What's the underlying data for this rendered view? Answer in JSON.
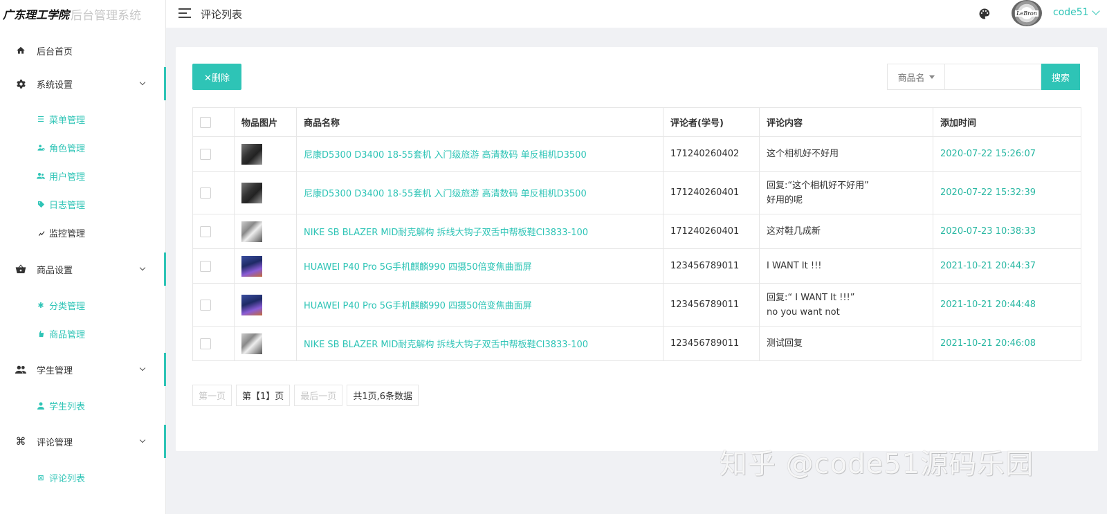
{
  "header": {
    "logo_main": "广东理工学院",
    "logo_sub": "后台管理系统",
    "title": "评论列表",
    "username": "code51",
    "avatar_text": "LeBron"
  },
  "sidebar": {
    "home": "后台首页",
    "groups": [
      {
        "label": "系统设置",
        "items": [
          "菜单管理",
          "角色管理",
          "用户管理",
          "日志管理",
          "监控管理"
        ]
      },
      {
        "label": "商品设置",
        "items": [
          "分类管理",
          "商品管理"
        ]
      },
      {
        "label": "学生管理",
        "items": [
          "学生列表"
        ]
      },
      {
        "label": "评论管理",
        "items": [
          "评论列表"
        ]
      }
    ]
  },
  "toolbar": {
    "delete_label": "✕删除",
    "search_field": "商品名",
    "search_placeholder": "",
    "search_label": "搜索"
  },
  "table": {
    "headers": [
      "",
      "物品图片",
      "商品名称",
      "评论者(学号)",
      "评论内容",
      "添加时间"
    ],
    "rows": [
      {
        "product": "尼康D5300 D3400 18-55套机 入门级旅游 高清数码 单反相机D3500",
        "user": "171240260402",
        "content": [
          "这个相机好不好用"
        ],
        "time": "2020-07-22 15:26:07",
        "img": "cam"
      },
      {
        "product": "尼康D5300 D3400 18-55套机 入门级旅游 高清数码 单反相机D3500",
        "user": "171240260401",
        "content": [
          "回复:“这个相机好不好用”",
          "好用的呢"
        ],
        "time": "2020-07-22 15:32:39",
        "img": "cam"
      },
      {
        "product": "NIKE SB BLAZER MID耐克解构 拆线大钩子双舌中帮板鞋CI3833-100",
        "user": "171240260401",
        "content": [
          "这对鞋几成新"
        ],
        "time": "2020-07-23 10:38:33",
        "img": "shoe"
      },
      {
        "product": "HUAWEI P40 Pro 5G手机麒麟990 四摄50倍变焦曲面屏",
        "user": "123456789011",
        "content": [
          "I WANT It !!!"
        ],
        "time": "2021-10-21 20:44:37",
        "img": "phone"
      },
      {
        "product": "HUAWEI P40 Pro 5G手机麒麟990 四摄50倍变焦曲面屏",
        "user": "123456789011",
        "content": [
          "回复:“ I WANT It !!!”",
          "no you want not"
        ],
        "time": "2021-10-21 20:44:48",
        "img": "phone"
      },
      {
        "product": "NIKE SB BLAZER MID耐克解构 拆线大钩子双舌中帮板鞋CI3833-100",
        "user": "123456789011",
        "content": [
          "测试回复"
        ],
        "time": "2021-10-21 20:46:08",
        "img": "shoe"
      }
    ]
  },
  "pager": {
    "first": "第一页",
    "current": "第【1】页",
    "last": "最后一页",
    "summary": "共1页,6条数据"
  },
  "watermark": "知乎 @code51源码乐园",
  "colors": {
    "accent": "#2ec4b6"
  }
}
